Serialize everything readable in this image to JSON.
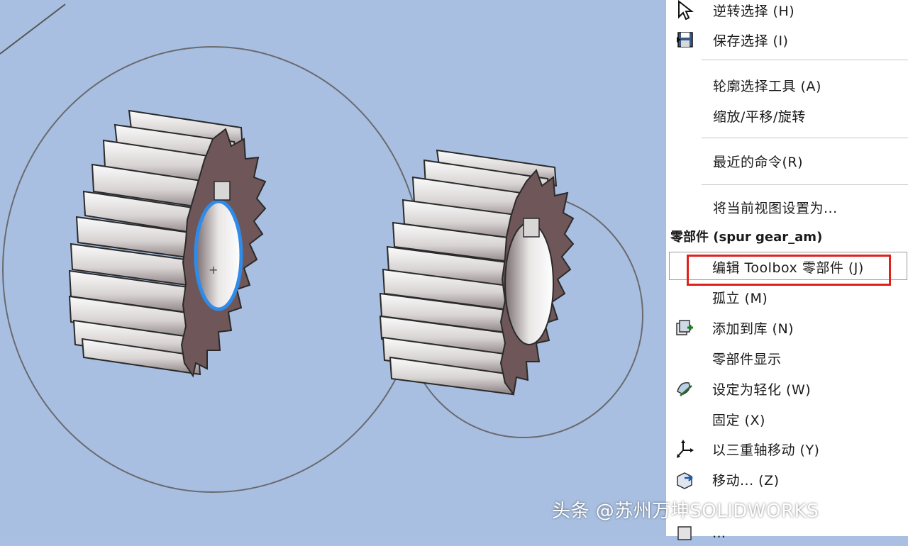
{
  "menu": {
    "items_top": [
      {
        "label": "逆转选择 (H)",
        "icon": "cursor-arrow-icon"
      },
      {
        "label": "保存选择 (I)",
        "icon": "save-selection-icon"
      },
      {
        "label": "轮廓选择工具 (A)",
        "icon": ""
      },
      {
        "label": "缩放/平移/旋转",
        "icon": ""
      },
      {
        "label": "最近的命令(R)",
        "icon": ""
      },
      {
        "label": "将当前视图设置为...",
        "icon": ""
      }
    ],
    "section_header": "零部件 (spur gear_am)",
    "items_component": [
      {
        "label": "编辑 Toolbox 零部件 (J)",
        "icon": ""
      },
      {
        "label": "孤立 (M)",
        "icon": ""
      },
      {
        "label": "添加到库 (N)",
        "icon": "add-to-library-icon"
      },
      {
        "label": "零部件显示",
        "icon": ""
      },
      {
        "label": "设定为轻化 (W)",
        "icon": "lightweight-icon"
      },
      {
        "label": "固定 (X)",
        "icon": ""
      },
      {
        "label": "以三重轴移动 (Y)",
        "icon": "triad-move-icon"
      },
      {
        "label": "移动... (Z)",
        "icon": "move-component-icon"
      },
      {
        "label": "…",
        "icon": "component-icon"
      }
    ]
  },
  "watermark": "头条 @苏州万坤SOLIDWORKS",
  "colors": {
    "viewport_bg": "#a8bfe1",
    "highlight_border": "#e0201b",
    "gear_face": "#6e5659",
    "selection_blue": "#2f8bea"
  }
}
